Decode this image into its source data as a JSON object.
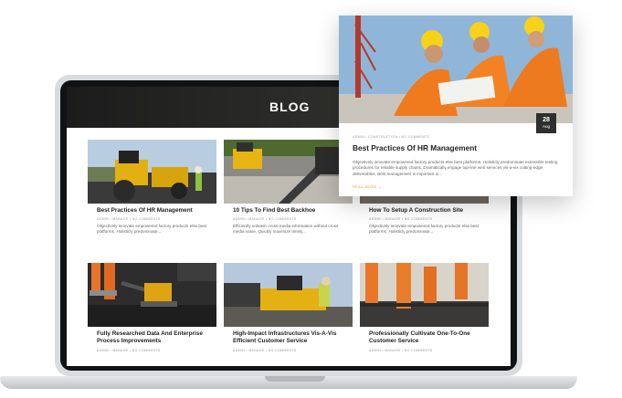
{
  "blog": {
    "title": "BLOG"
  },
  "featured": {
    "image": "construction-workers-photo",
    "date_day": "28",
    "date_month": "Aug",
    "meta": "ADMIN  /  CONSTRUCTION  /  NO COMMENTS",
    "title": "Best Practices Of HR Management",
    "excerpt": "Objectively innovate empowered factory products else best platforms. Holisticly predominate extensible testing procedures for reliable supply chains. Dramatically engage top-line web services vis-a-vis cutting-edge deliverables. Best management is important in...",
    "read_more": "READ MORE →"
  },
  "posts": [
    {
      "title": "Best Practices Of HR Management",
      "meta": "ADMIN  •  MANAGE  •  NO COMMENTS",
      "excerpt": "Objectively innovate empowered factory products else best platforms. Holisticly predominate...",
      "image": "road-roller-photo"
    },
    {
      "title": "10 Tips To Find Best Backhoe",
      "meta": "ADMIN  •  MANAGE  •  NO COMMENTS",
      "excerpt": "Efficiently unleash cross-media information without cross media value. Quickly maximize timely...",
      "image": "paving-asphalt-photo"
    },
    {
      "title": "How To Setup A Construction Site",
      "meta": "ADMIN  •  MANAGE  •  NO COMMENTS",
      "excerpt": "Objectively innovate empowered factory products else best platforms. Holisticly predominate...",
      "image": "construction-site-photo"
    },
    {
      "title": "Fully Researched Data And Enterprise Process Improvements",
      "meta": "ADMIN  •  MANAGE  •  NO COMMENTS",
      "excerpt": "",
      "image": "plate-compactor-photo"
    },
    {
      "title": "High-Impact Infrastructures Vis-A-Vis Efficient Customer Service",
      "meta": "ADMIN  •  MANAGE  •  NO COMMENTS",
      "excerpt": "",
      "image": "asphalt-paver-photo"
    },
    {
      "title": "Professionally Cultivate One-To-One Customer Service",
      "meta": "ADMIN  •  MANAGE  •  NO COMMENTS",
      "excerpt": "",
      "image": "road-workers-photo"
    }
  ],
  "colors": {
    "accent": "#e8a20c",
    "header_bg": "#1c1c1c",
    "title_text": "#222222",
    "body_text": "#666666"
  }
}
